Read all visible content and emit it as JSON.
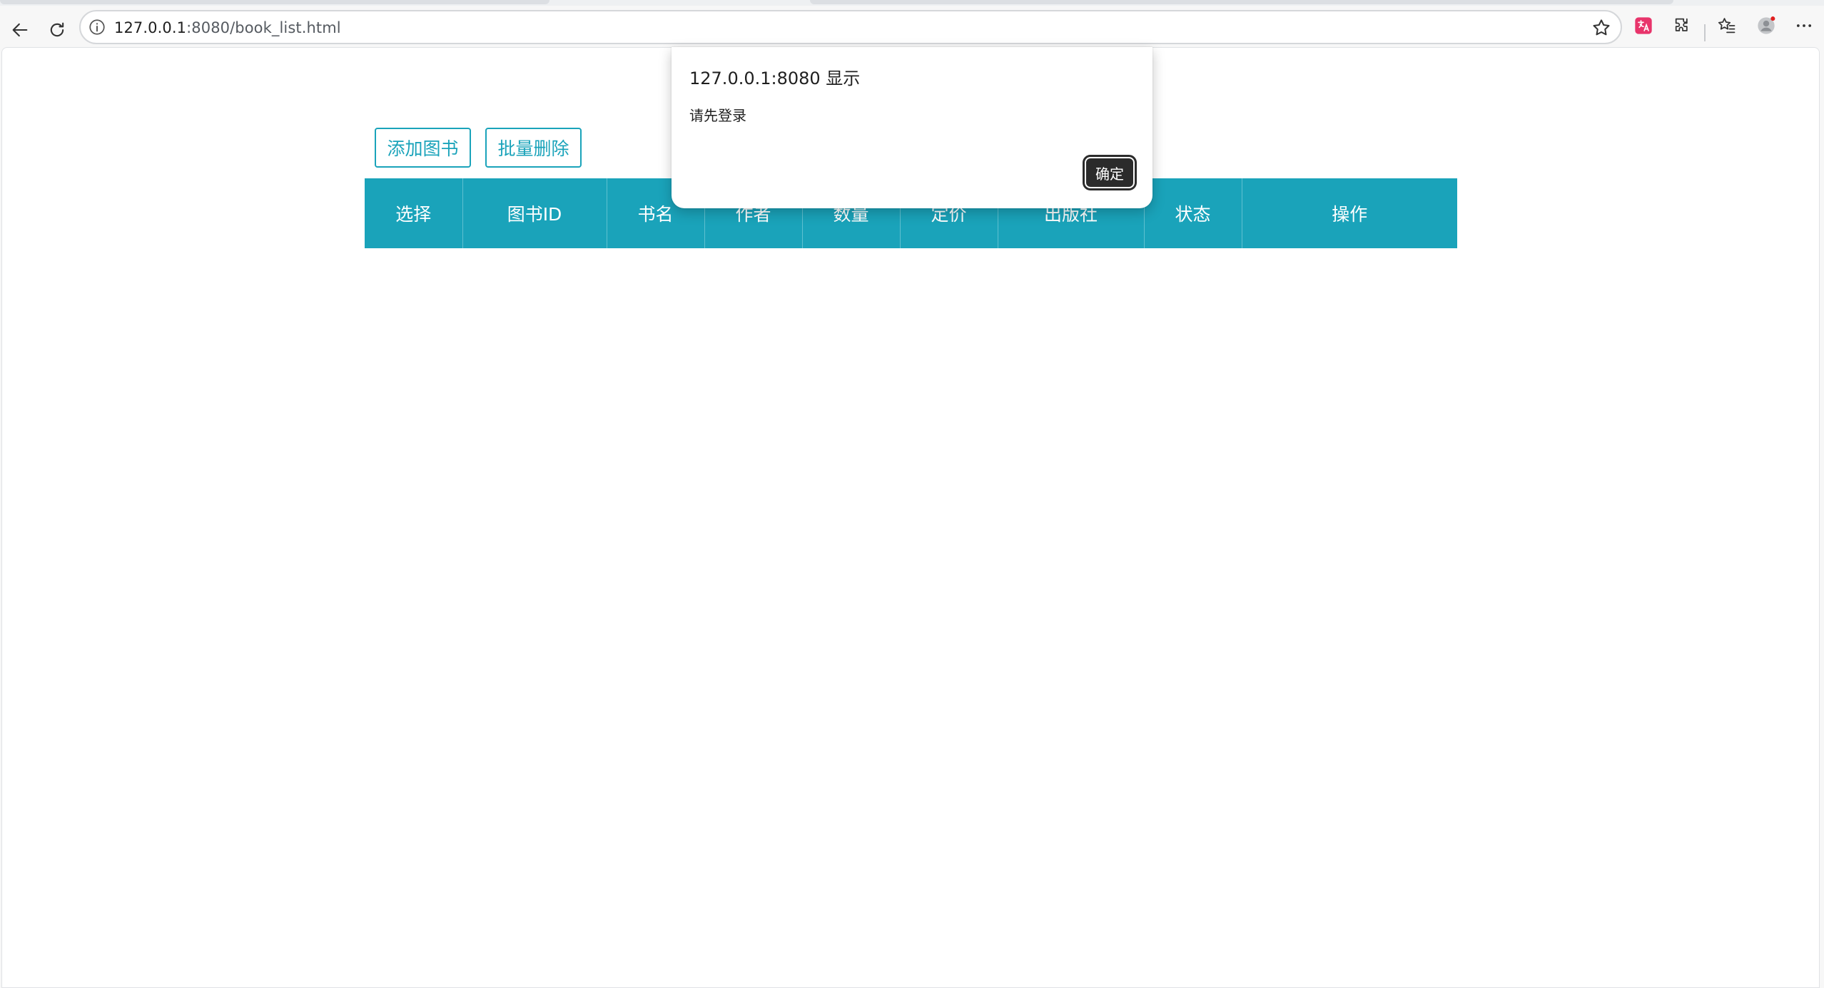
{
  "browser": {
    "url_host": "127.0.0.1",
    "url_rest": ":8080/book_list.html"
  },
  "page": {
    "add_button": "添加图书",
    "batch_delete_button": "批量删除",
    "table": {
      "columns": [
        "选择",
        "图书ID",
        "书名",
        "作者",
        "数量",
        "定价",
        "出版社",
        "状态",
        "操作"
      ],
      "rows": []
    }
  },
  "dialog": {
    "title": "127.0.0.1:8080 显示",
    "message": "请先登录",
    "ok_label": "确定"
  },
  "colors": {
    "accent": "#1aa3ba",
    "dialog_button": "#2b2b2b"
  }
}
